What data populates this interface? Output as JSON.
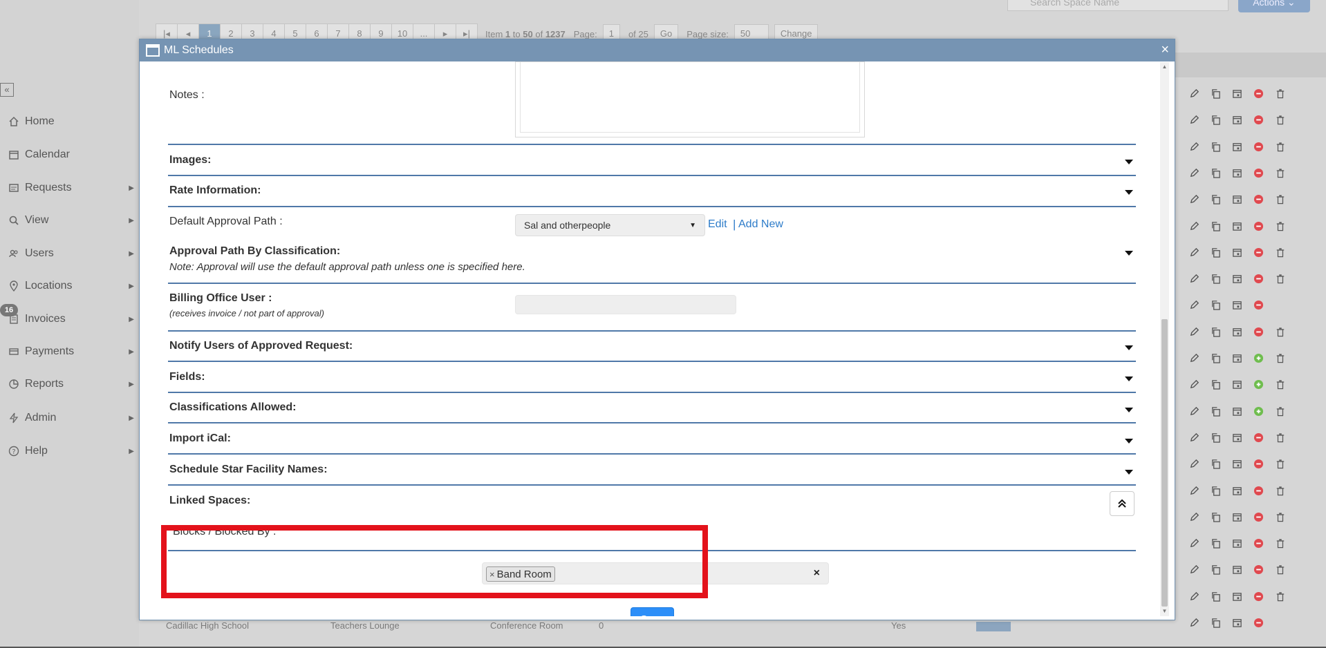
{
  "sidebar": {
    "collapse_icon": "double-chevron-left-icon",
    "items": [
      {
        "label": "Home",
        "icon": "home-icon",
        "has_arrow": false
      },
      {
        "label": "Calendar",
        "icon": "calendar-icon",
        "has_arrow": false
      },
      {
        "label": "Requests",
        "icon": "requests-icon",
        "has_arrow": true
      },
      {
        "label": "View",
        "icon": "search-icon",
        "has_arrow": true
      },
      {
        "label": "Users",
        "icon": "users-icon",
        "has_arrow": true
      },
      {
        "label": "Locations",
        "icon": "location-pin-icon",
        "has_arrow": true
      },
      {
        "label": "Invoices",
        "icon": "invoice-icon",
        "has_arrow": true
      },
      {
        "label": "Payments",
        "icon": "payments-icon",
        "has_arrow": true
      },
      {
        "label": "Reports",
        "icon": "reports-icon",
        "has_arrow": true
      },
      {
        "label": "Admin",
        "icon": "bolt-icon",
        "has_arrow": true
      },
      {
        "label": "Help",
        "icon": "help-icon",
        "has_arrow": true
      }
    ],
    "invoice_badge": "16"
  },
  "background": {
    "pager": {
      "pages": [
        "1",
        "2",
        "3",
        "4",
        "5",
        "6",
        "7",
        "8",
        "9",
        "10",
        "..."
      ],
      "active_page": "1",
      "item_prefix": "Item",
      "item_from": "1",
      "item_to_word": "to",
      "item_to": "50",
      "item_of_word": "of",
      "item_total": "1237",
      "page_label": "Page:",
      "page_value": "1",
      "page_of": "of 25",
      "go_label": "Go",
      "page_size_label": "Page size:",
      "page_size_value": "50",
      "change_label": "Change"
    },
    "search_placeholder": "Search Space Name",
    "actions_label": "Actions",
    "row_action_pattern": [
      "trash",
      "trash",
      "trash",
      "trash",
      "trash",
      "trash",
      "trash",
      "trash",
      "none",
      "trash",
      "trash",
      "trash",
      "trash",
      "trash",
      "trash",
      "trash",
      "trash",
      "trash",
      "trash",
      "trash",
      "none"
    ],
    "row_status": [
      "red",
      "red",
      "red",
      "red",
      "red",
      "red",
      "red",
      "red",
      "red",
      "red",
      "green",
      "green",
      "green",
      "red",
      "red",
      "red",
      "red",
      "red",
      "red",
      "red",
      "red"
    ],
    "bottom_row": {
      "col1": "Cadillac High School",
      "col2": "Teachers Lounge",
      "col3": "Conference Room",
      "col4": "0",
      "col5": "Yes"
    }
  },
  "modal": {
    "title": "ML Schedules",
    "notes_label": "Notes :",
    "sections": {
      "images": "Images:",
      "rate_information": "Rate Information:",
      "default_approval_path": "Default Approval Path :",
      "approval_by_classification": "Approval Path By Classification:",
      "approval_note": "Note: Approval will use the default approval path unless one is specified here.",
      "billing_office_user": "Billing Office User :",
      "billing_note": "(receives invoice / not part of approval)",
      "notify_users": "Notify Users of Approved Request:",
      "fields": "Fields:",
      "classifications_allowed": "Classifications Allowed:",
      "import_ical": "Import iCal:",
      "schedule_star": "Schedule Star Facility Names:",
      "linked_spaces": "Linked Spaces:",
      "blocks_label": "Blocks / Blocked By :"
    },
    "approval_select_value": "Sal and otherpeople",
    "edit_link": "Edit",
    "link_separator": "|",
    "add_new_link": "Add New",
    "linked_tag": "Band Room",
    "tag_remove_glyph": "×",
    "tag_clear_glyph": "×",
    "close_glyph": "×",
    "save_label": "Save"
  },
  "colors": {
    "modal_titlebar": "#7694b3",
    "section_rule": "#4f78a8",
    "link": "#2e7cc9",
    "save_button": "#2c8ef8",
    "highlight": "#e3121b",
    "status_red": "#e0494f",
    "status_green": "#6fbd4e"
  }
}
